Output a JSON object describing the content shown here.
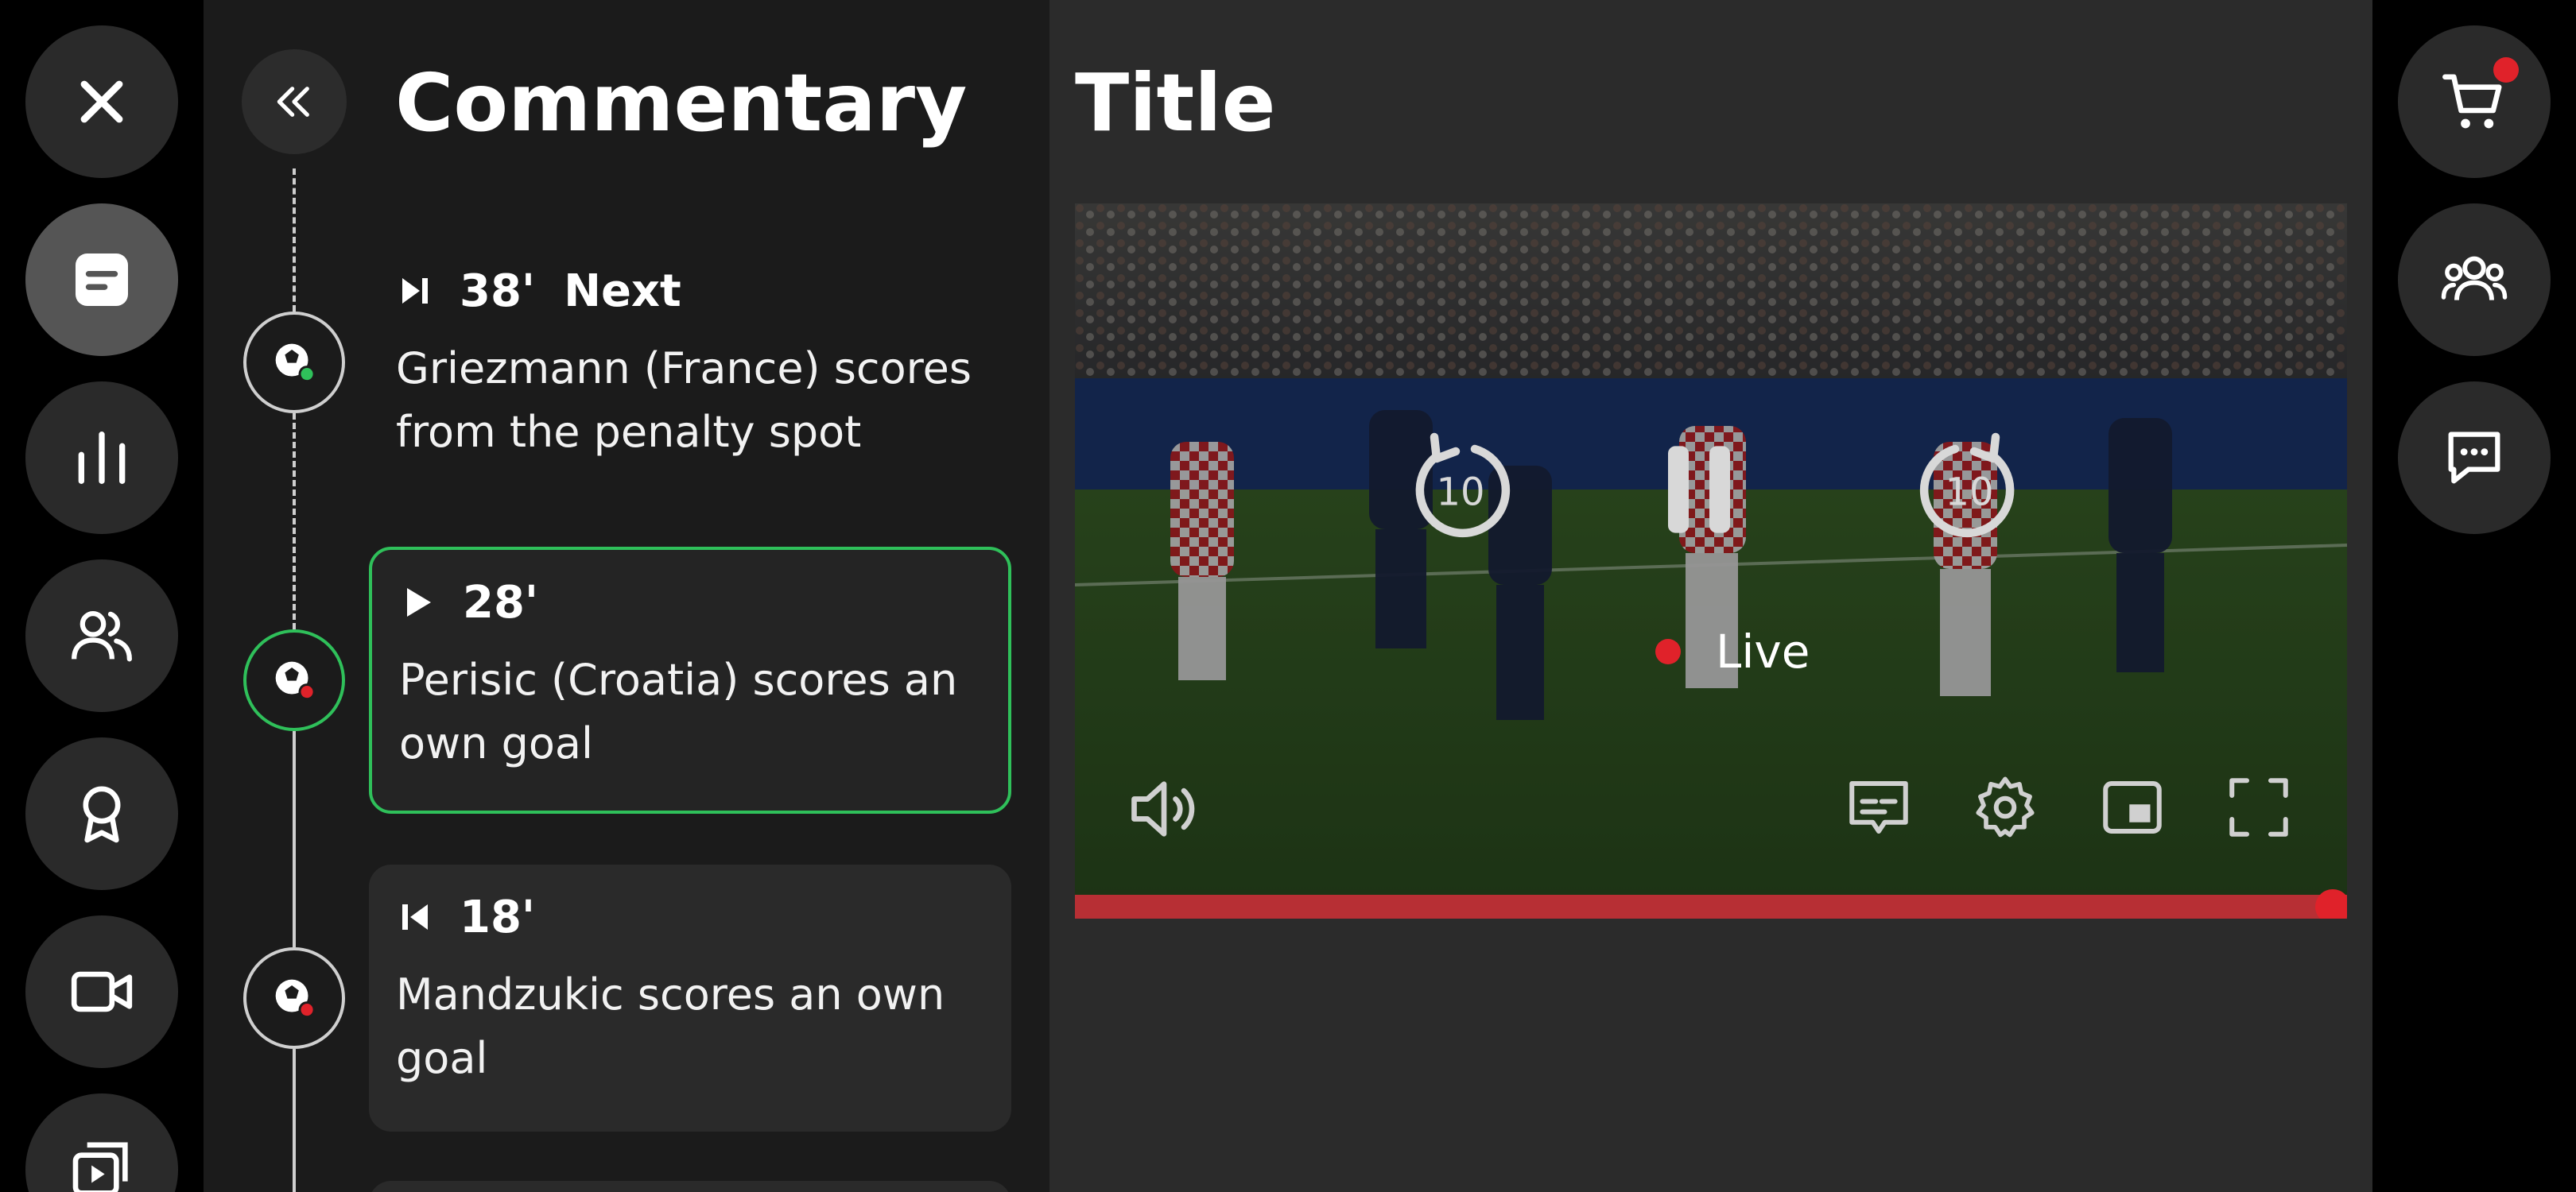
{
  "left_rail": {
    "items": [
      {
        "icon": "close-icon"
      },
      {
        "icon": "document-icon",
        "active": true
      },
      {
        "icon": "stats-icon"
      },
      {
        "icon": "people-icon"
      },
      {
        "icon": "award-icon"
      },
      {
        "icon": "video-camera-icon"
      },
      {
        "icon": "playlist-icon"
      }
    ]
  },
  "commentary": {
    "title": "Commentary",
    "collapse_icon": "double-chevron-left-icon",
    "events": [
      {
        "minute": "38'",
        "tag": "Next",
        "text": "Griezmann (France) scores from the penalty spot",
        "state": "next",
        "icon": "skip-next-icon",
        "status_color": "#2fc05a"
      },
      {
        "minute": "28'",
        "tag": "",
        "text": "Perisic (Croatia) scores an own goal",
        "state": "current",
        "icon": "play-icon",
        "status_color": "#e0222a"
      },
      {
        "minute": "18'",
        "tag": "",
        "text": "Mandzukic scores an own goal",
        "state": "past",
        "icon": "skip-previous-icon",
        "status_color": "#e0222a"
      }
    ]
  },
  "main": {
    "title": "Title",
    "player": {
      "rewind_label": "10",
      "forward_label": "10",
      "live_label": "Live",
      "progress": 1.0,
      "controls": [
        "volume-icon",
        "subtitles-icon",
        "settings-icon",
        "picture-in-picture-icon",
        "fullscreen-icon"
      ]
    }
  },
  "right_rail": {
    "items": [
      {
        "icon": "cart-icon",
        "has_notification": true
      },
      {
        "icon": "group-icon"
      },
      {
        "icon": "chat-icon"
      }
    ]
  },
  "colors": {
    "accent_green": "#2fc05a",
    "live_red": "#e0222a",
    "panel_bg": "#1b1b1b",
    "main_bg": "#2b2b2b"
  }
}
